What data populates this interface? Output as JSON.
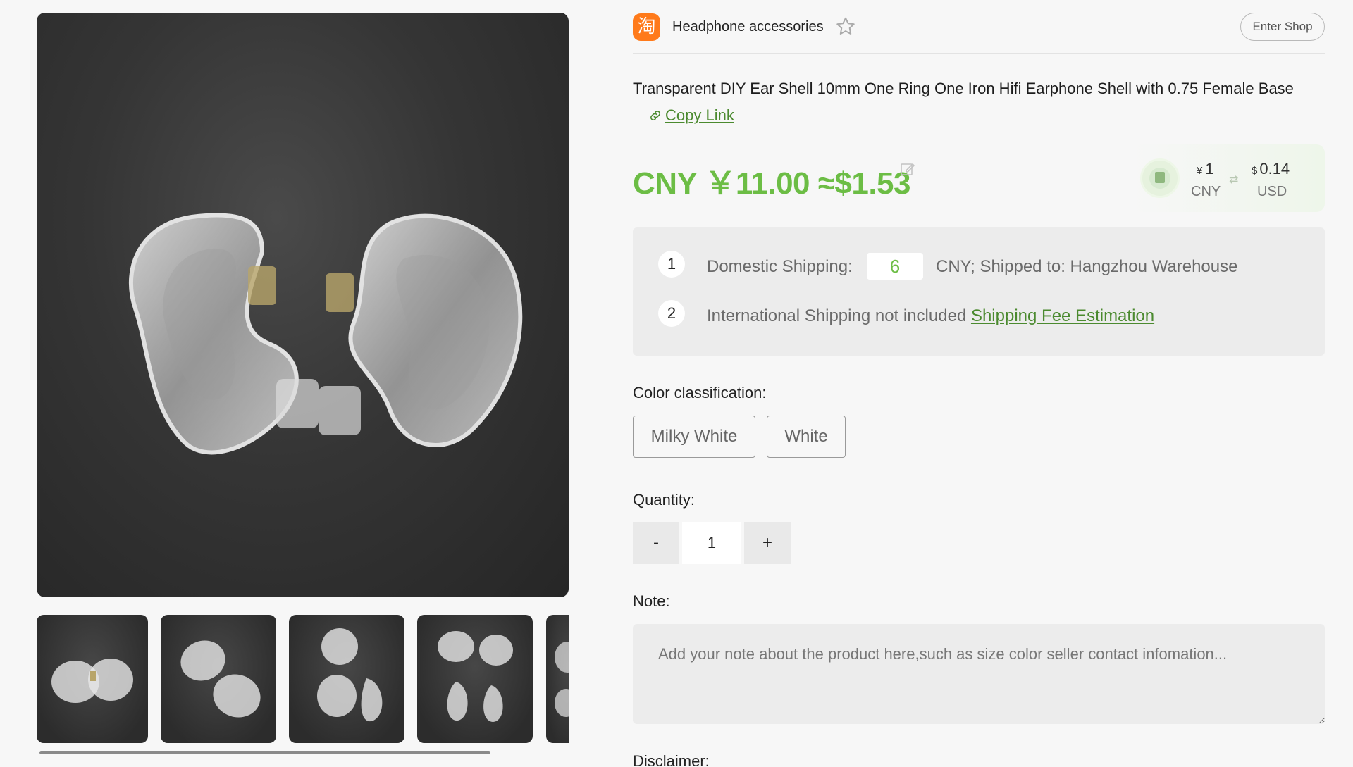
{
  "gallery": {
    "main_image": "clear-earphone-shells-photo",
    "thumbnails": [
      {
        "icon": "earphone-shells-pair"
      },
      {
        "icon": "earphone-shells-angled"
      },
      {
        "icon": "earphone-shells-stacked"
      },
      {
        "icon": "earphone-shells-four"
      },
      {
        "icon": "earphone-shells-partial"
      }
    ]
  },
  "shop": {
    "logo_char": "淘",
    "name": "Headphone accessories",
    "favorite_icon": "star-icon",
    "enter_label": "Enter Shop"
  },
  "product": {
    "title": "Transparent DIY Ear Shell 10mm One Ring One Iron Hifi Earphone Shell with 0.75 Female Base",
    "copy_link": "Copy Link",
    "price": "CNY ￥11.00 ≈$1.53",
    "exchange": {
      "cny_symbol": "¥",
      "cny_value": "1",
      "cny_label": "CNY",
      "usd_symbol": "$",
      "usd_value": "0.14",
      "usd_label": "USD"
    }
  },
  "shipping": {
    "step1_num": "1",
    "step1_label": "Domestic Shipping:",
    "step1_value": "6",
    "step1_suffix": "CNY; Shipped to: Hangzhou Warehouse",
    "step2_num": "2",
    "step2_label": "International Shipping not included",
    "step2_link": "Shipping Fee Estimation"
  },
  "options": {
    "color_label": "Color classification:",
    "colors": [
      "Milky White",
      "White"
    ],
    "quantity_label": "Quantity:",
    "minus": "-",
    "quantity": "1",
    "plus": "+",
    "note_label": "Note:",
    "note_placeholder": "Add your note about the product here,such as size color seller contact infomation...",
    "disclaimer_label": "Disclaimer:"
  },
  "colors": {
    "accent_green": "#6cbd45",
    "link_green": "#4b8a2f",
    "shop_orange": "#ff7a1a"
  }
}
